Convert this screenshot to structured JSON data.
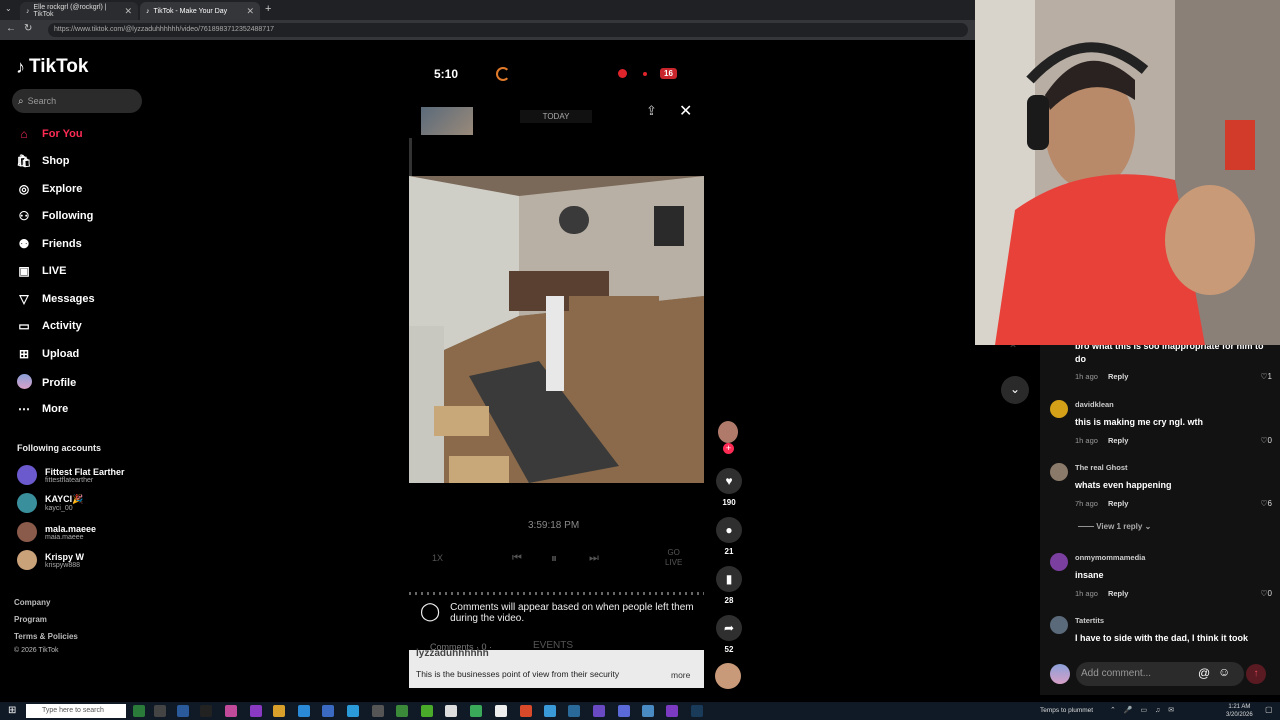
{
  "browser": {
    "tabs": [
      {
        "label": "Elle rockgrl (@rockgrl) | TikTok",
        "active": false
      },
      {
        "label": "TikTok - Make Your Day",
        "active": true
      }
    ],
    "new_tab": "+",
    "url": "https://www.tiktok.com/@lyzzaduhhhhhh/video/7618983712352488717"
  },
  "sidebar": {
    "logo_text": "TikTok",
    "search_placeholder": "Search",
    "nav": [
      {
        "label": "For You",
        "icon": "home-icon",
        "active": true
      },
      {
        "label": "Shop",
        "icon": "shop-icon"
      },
      {
        "label": "Explore",
        "icon": "compass-icon"
      },
      {
        "label": "Following",
        "icon": "following-icon"
      },
      {
        "label": "Friends",
        "icon": "friends-icon"
      },
      {
        "label": "LIVE",
        "icon": "live-icon"
      },
      {
        "label": "Messages",
        "icon": "messages-icon"
      },
      {
        "label": "Activity",
        "icon": "activity-icon"
      },
      {
        "label": "Upload",
        "icon": "upload-icon"
      },
      {
        "label": "Profile",
        "icon": "profile-icon"
      },
      {
        "label": "More",
        "icon": "more-icon"
      }
    ],
    "following_header": "Following accounts",
    "accounts": [
      {
        "name": "Fittest Flat Earther",
        "handle": "fittestflatearther",
        "color": "#6a5acd"
      },
      {
        "name": "KAYCI🎉",
        "handle": "kayci_00",
        "color": "#3a8f9c"
      },
      {
        "name": "mala.maeee",
        "handle": "maia.maeee",
        "color": "#8a5a4a"
      },
      {
        "name": "Krispy W",
        "handle": "krispyw888",
        "color": "#c9a27a"
      }
    ],
    "footer": [
      "Company",
      "Program",
      "Terms & Policies",
      "© 2026 TikTok"
    ]
  },
  "player": {
    "status_time": "5:10",
    "badge_count": "16",
    "today_label": "TODAY",
    "timestamp": "3:59:18 PM",
    "speed": "1X",
    "go_live": "GO\nLIVE",
    "comments_note": "Comments will appear based on when people left them during the video.",
    "comments_tab": "Comments · 0 ·",
    "events_tab": "EVENTS",
    "author": "lyzzaduhhhhhh",
    "caption": "This is the businesses point of view from their security",
    "more": "more"
  },
  "actions": {
    "likes": "190",
    "comments": "21",
    "saves": "28",
    "shares": "52"
  },
  "comments": [
    {
      "user": "",
      "text": "bro what this is soo inappropriate for him to do",
      "time": "1h ago",
      "likes": "1",
      "color": "#444"
    },
    {
      "user": "davidklean",
      "text": "this is making me cry ngl. wth",
      "time": "1h ago",
      "likes": "0",
      "color": "#d4a017"
    },
    {
      "user": "The real Ghost",
      "text": "whats even happening",
      "time": "7h ago",
      "likes": "6",
      "color": "#8a7a6a"
    },
    {
      "user": "onmymommamedia",
      "text": "insane",
      "time": "1h ago",
      "likes": "0",
      "color": "#7b3fa0"
    },
    {
      "user": "Tatertits",
      "text": "I have to side with the dad, I think it took",
      "time": "",
      "likes": "",
      "color": "#5a6a7a"
    }
  ],
  "view_replies": "View 1 reply",
  "reply_label": "Reply",
  "add_comment_placeholder": "Add comment...",
  "taskbar": {
    "search_placeholder": "Type here to search",
    "weather": "Temps to plummet",
    "clock_time": "1:21 AM",
    "clock_date": "3/20/2026"
  }
}
